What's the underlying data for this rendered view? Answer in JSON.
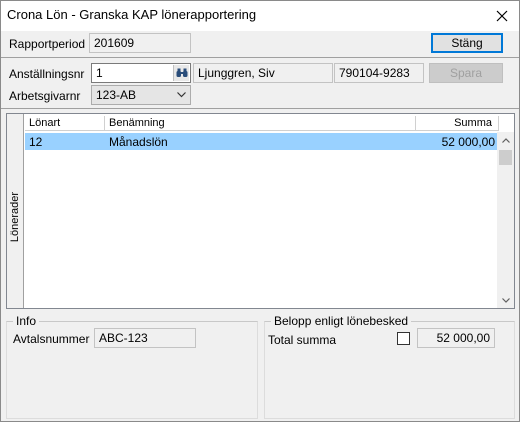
{
  "window": {
    "title": "Crona Lön - Granska KAP lönerapportering"
  },
  "header": {
    "period_label": "Rapportperiod",
    "period_value": "201609",
    "close_button": "Stäng",
    "employee_no_label": "Anställningsnr",
    "employee_no_value": "1",
    "employee_name": "Ljunggren, Siv",
    "personal_id": "790104-9283",
    "save_button": "Spara",
    "employer_label": "Arbetsgivarnr",
    "employer_value": "123-AB"
  },
  "grid": {
    "tab_label": "Lönerader",
    "columns": [
      "Lönart",
      "Benämning",
      "Summa"
    ],
    "rows": [
      {
        "code": "12",
        "name": "Månadslön",
        "amount": "52 000,00"
      }
    ]
  },
  "info": {
    "title": "Info",
    "agreement_label": "Avtalsnummer",
    "agreement_value": "ABC-123"
  },
  "payslip": {
    "title": "Belopp enligt lönebesked",
    "total_label": "Total summa",
    "total_checked": false,
    "total_value": "52 000,00"
  },
  "icons": {
    "close": "close-icon",
    "search": "binoculars-icon",
    "dropdown": "chevron-down-icon",
    "scroll_up": "chevron-up-icon",
    "scroll_down": "chevron-down-icon"
  },
  "colors": {
    "selected_row": "#99d1ff",
    "default_button_border": "#0078d7"
  }
}
